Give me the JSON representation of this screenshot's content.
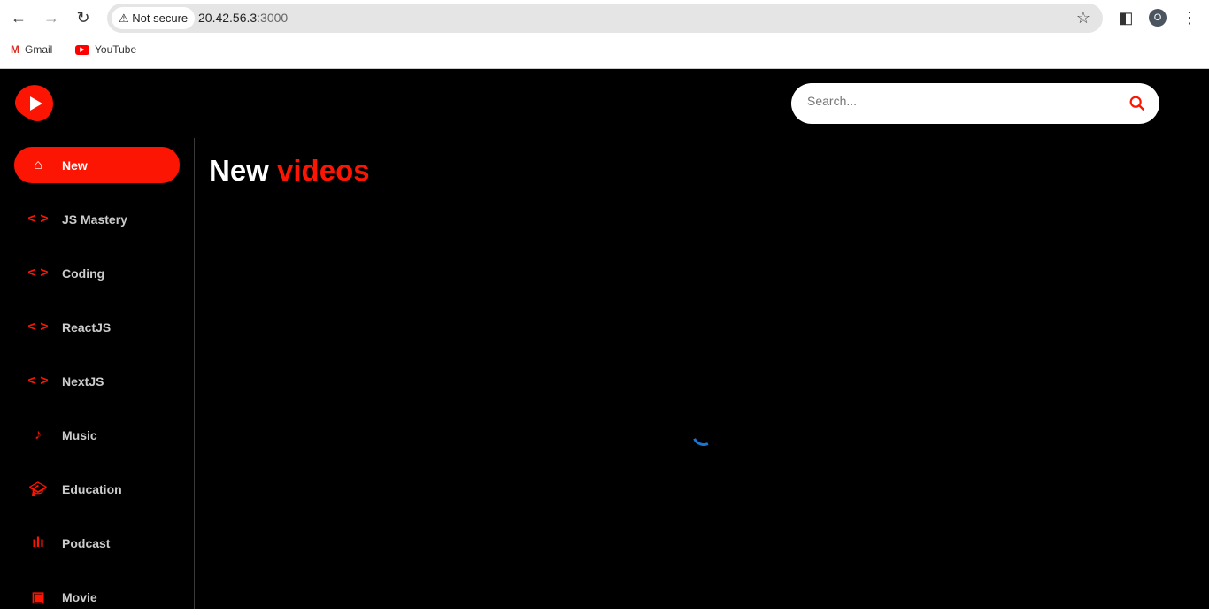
{
  "browser": {
    "security": "Not secure",
    "url_host": "20.42.56.3",
    "url_port": ":3000",
    "profile": "O",
    "bookmarks": [
      {
        "label": "Gmail"
      },
      {
        "label": "YouTube"
      }
    ]
  },
  "search": {
    "placeholder": "Search..."
  },
  "sidebar": {
    "items": [
      {
        "label": "New",
        "icon": "home-icon",
        "active": true
      },
      {
        "label": "JS Mastery",
        "icon": "code-icon"
      },
      {
        "label": "Coding",
        "icon": "code-icon"
      },
      {
        "label": "ReactJS",
        "icon": "code-icon"
      },
      {
        "label": "NextJS",
        "icon": "code-icon"
      },
      {
        "label": "Music",
        "icon": "music-note-icon"
      },
      {
        "label": "Education",
        "icon": "school-icon"
      },
      {
        "label": "Podcast",
        "icon": "graphic-eq-icon"
      },
      {
        "label": "Movie",
        "icon": "ondemand-video-icon"
      }
    ]
  },
  "main": {
    "title_white": "New",
    "title_red": "videos"
  },
  "colors": {
    "accent": "#FC1503",
    "background": "#000000",
    "spinner": "#1976d2"
  }
}
